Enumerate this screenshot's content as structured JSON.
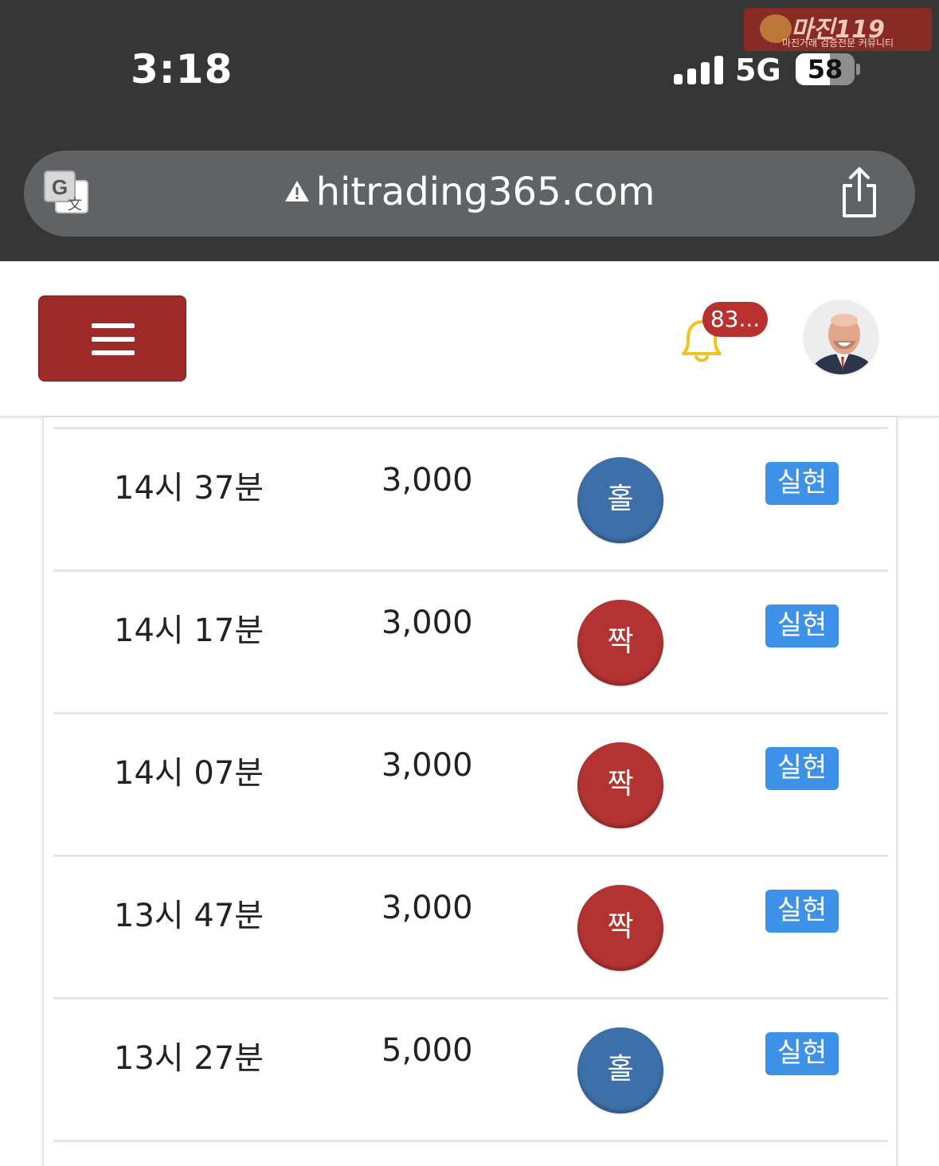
{
  "status_bar": {
    "time": "3:18",
    "network": "5G",
    "battery_percent": "58",
    "battery_level": 0.58
  },
  "watermark": {
    "title": "마진119",
    "subtitle": "마진거래 검증전문 커뮤니티"
  },
  "browser": {
    "url": "hitrading365.com"
  },
  "header": {
    "notification_count": "83..."
  },
  "colors": {
    "menu_button": "#9e2a2a",
    "odd_ball": "#3d6fa8",
    "even_ball": "#b23332",
    "status_tag": "#3d92e8",
    "bell": "#f3c11b"
  },
  "rows": [
    {
      "time": "14시 37분",
      "amount": "3,000",
      "result": "홀",
      "result_type": "odd",
      "status": "실현"
    },
    {
      "time": "14시 17분",
      "amount": "3,000",
      "result": "짝",
      "result_type": "even",
      "status": "실현"
    },
    {
      "time": "14시 07분",
      "amount": "3,000",
      "result": "짝",
      "result_type": "even",
      "status": "실현"
    },
    {
      "time": "13시 47분",
      "amount": "3,000",
      "result": "짝",
      "result_type": "even",
      "status": "실현"
    },
    {
      "time": "13시 27분",
      "amount": "5,000",
      "result": "홀",
      "result_type": "odd",
      "status": "실현"
    }
  ]
}
